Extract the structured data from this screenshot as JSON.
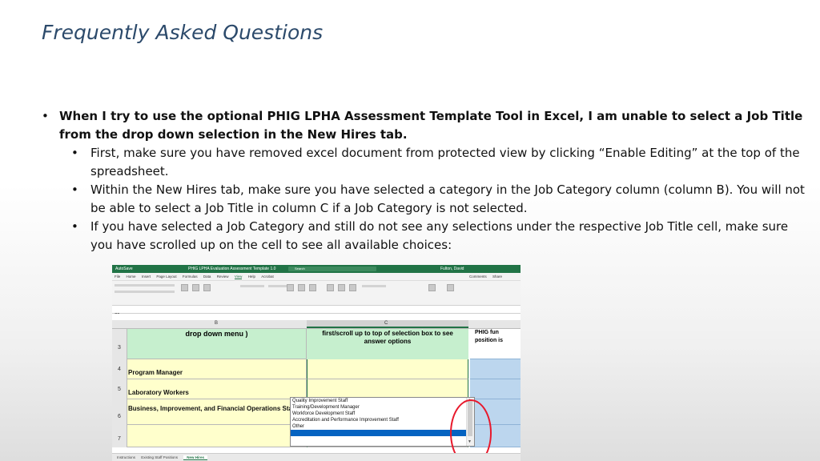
{
  "title": "Frequently Asked Questions",
  "main_bullet": "When I try to use the optional PHIG LPHA Assessment Template Tool in Excel, I am unable to select a Job Title from the drop down selection in the New Hires tab.",
  "sub_bullets": [
    "First, make sure you have removed excel document from protected view by clicking “Enable Editing” at the top of the spreadsheet.",
    "Within the New Hires tab, make sure you have selected a category in the Job Category column (column B).  You will not be able to select a Job Title in column C if a Job Category is not selected.",
    "If you have selected a Job Category and still do not see any selections under the respective Job Title cell, make sure you have scrolled up on the cell to see all available choices:"
  ],
  "excel": {
    "window_title": "PHIG LPHA Evaluation Assessment Template 1.0",
    "search_placeholder": "Search",
    "autosave_label": "AutoSave",
    "user_label": "Fulton, David",
    "menu": [
      "File",
      "Home",
      "Insert",
      "Page Layout",
      "Formulas",
      "Data",
      "Review",
      "View",
      "Help",
      "Acrobat"
    ],
    "active_menu": "View",
    "comments_label": "Comments",
    "share_label": "Share",
    "name_box": "C6",
    "column_b": "B",
    "column_c": "C",
    "header_b": "drop down menu )",
    "header_c_line1": "first/scroll up to top of selection box to see",
    "header_c_line2": "answer options",
    "header_d_line1": "PHIG fun",
    "header_d_line2": "position is",
    "rows": [
      {
        "num": "3",
        "b": ""
      },
      {
        "num": "4",
        "b": "Program Manager"
      },
      {
        "num": "5",
        "b": "Laboratory Workers"
      },
      {
        "num": "6",
        "b": "Business, Improvement, and Financial Operations Staff"
      },
      {
        "num": "7",
        "b": ""
      }
    ],
    "dropdown_items": [
      "Quality Improvement Staff",
      "Training/Development Manager",
      "Workforce Development Staff",
      "Accreditation and Performance Improvement Staff",
      "Other"
    ],
    "tabs": [
      "Instructions",
      "Existing Staff Positions",
      "New Hires"
    ],
    "active_tab": "New Hires",
    "colors": {
      "excel_green": "#217346",
      "highlight_yellow": "#ffffcc",
      "header_green": "#c6efce",
      "selection_blue": "#0563c1",
      "annotation_red": "#e8192c"
    }
  }
}
